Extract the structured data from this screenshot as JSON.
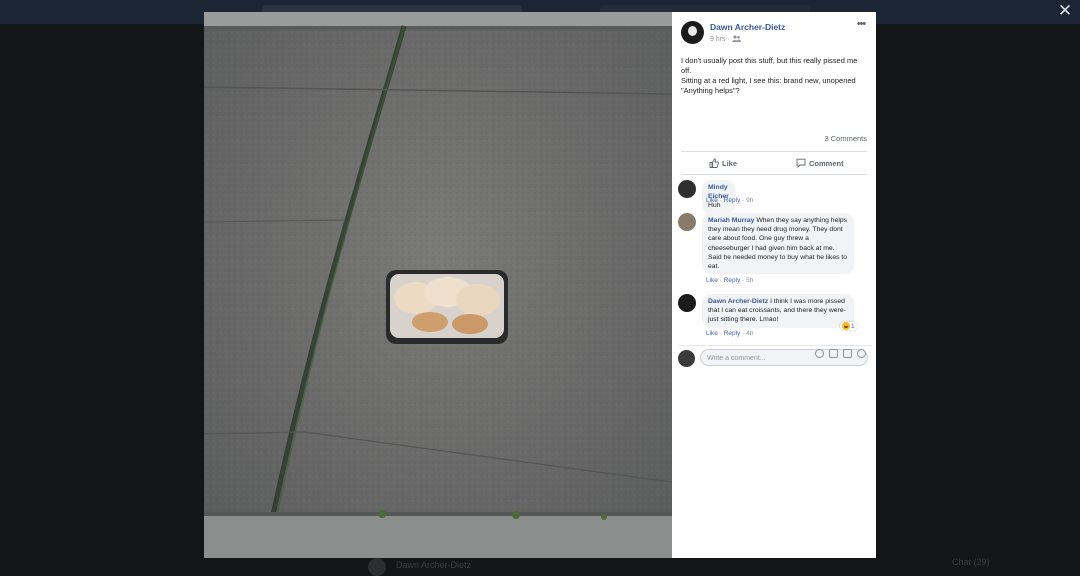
{
  "viewer": {
    "close_label": "✕"
  },
  "post": {
    "author": "Dawn Archer-Dietz",
    "time": "9 hrs",
    "privacy_icon": "friends-icon",
    "more_label": "•••",
    "text_lines": [
      "I don't usually post this stuff, but this really pissed me off.",
      "Sitting at a red light, I see this: brand new, unopened",
      "\"Anything helps\"?"
    ],
    "comments_count": "3 Comments",
    "like_label": "Like",
    "comment_label": "Comment"
  },
  "comments": [
    {
      "name": "Mindy Eicher",
      "text": "Huh",
      "like": "Like",
      "reply": "Reply",
      "time": "9h"
    },
    {
      "name": "Mariah Murray",
      "text": "When they say anything helps they mean they need drug money. They dont care about food. One guy threw a cheeseburger I had given him back at me. Said he needed money to buy what he likes to eat.",
      "like": "Like",
      "reply": "Reply",
      "time": "5h"
    },
    {
      "name": "Dawn Archer-Dietz",
      "text": "I think I was more pissed that I can eat croissants, and there they were- just sitting there. Lmao!",
      "like": "Like",
      "reply": "Reply",
      "time": "4h",
      "reaction_count": "1"
    }
  ],
  "composer": {
    "placeholder": "Write a comment...",
    "icons": [
      "emoji-icon",
      "camera-icon",
      "gif-icon",
      "sticker-icon"
    ]
  },
  "background": {
    "bottom_name": "Dawn Archer-Dietz",
    "chat_label": "Chat (29)"
  }
}
